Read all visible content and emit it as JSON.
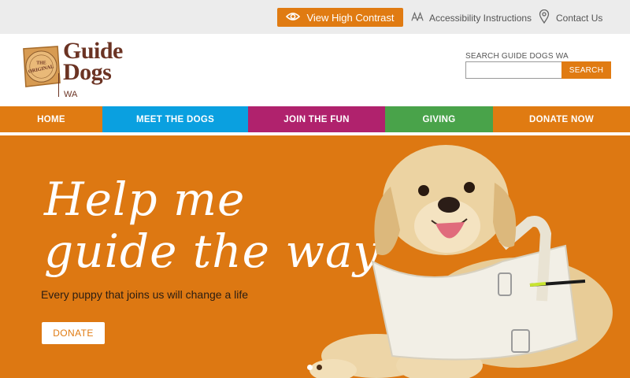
{
  "utility": {
    "contrast_label": "View High Contrast",
    "accessibility_label": "Accessibility Instructions",
    "contact_label": "Contact Us",
    "colors": {
      "bar": "#ececec",
      "accent": "#e07b12"
    }
  },
  "header": {
    "logo": {
      "line1": "Guide",
      "line2": "Dogs",
      "region": "WA",
      "seal_text": "THE ORIGINAL"
    },
    "search": {
      "label": "SEARCH GUIDE DOGS WA",
      "value": "",
      "button_label": "SEARCH"
    }
  },
  "nav": {
    "items": [
      {
        "label": "HOME",
        "color": "#e07b12"
      },
      {
        "label": "MEET THE DOGS",
        "color": "#0aa0e0"
      },
      {
        "label": "JOIN THE FUN",
        "color": "#b0226d"
      },
      {
        "label": "GIVING",
        "color": "#49a34a"
      },
      {
        "label": "DONATE NOW",
        "color": "#e07b12"
      }
    ]
  },
  "hero": {
    "title_line1": "Help me",
    "title_line2": "guide the way",
    "subtitle": "Every puppy that joins us will change a life",
    "button_label": "DONATE",
    "background": "#dd7812",
    "slides": [
      {
        "active": true
      },
      {
        "active": false
      }
    ]
  }
}
